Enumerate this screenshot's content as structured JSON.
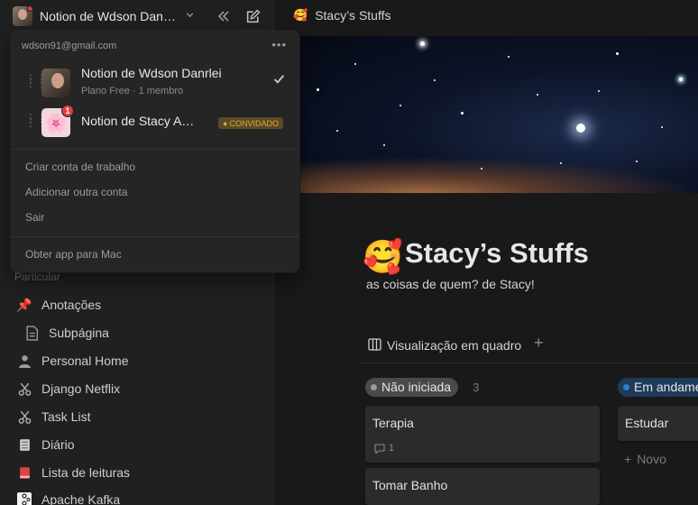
{
  "sidebar": {
    "workspace_name": "Notion de Wdson Dan…",
    "section_label": "Particular",
    "items": [
      {
        "label": "Anotações",
        "icon": "pushpin-icon"
      },
      {
        "label": "Subpágina",
        "icon": "page-icon"
      },
      {
        "label": "Personal Home",
        "icon": "person-icon"
      },
      {
        "label": "Django Netflix",
        "icon": "scissors-icon"
      },
      {
        "label": "Task List",
        "icon": "scissors-icon"
      },
      {
        "label": "Diário",
        "icon": "calendar-icon"
      },
      {
        "label": "Lista de leituras",
        "icon": "book-icon"
      },
      {
        "label": "Apache Kafka",
        "icon": "kafka-logo-icon"
      }
    ]
  },
  "dropdown": {
    "email": "wdson91@gmail.com",
    "accounts": [
      {
        "title": "Notion de Wdson Danrlei",
        "subtitle": "Plano Free · 1 membro",
        "selected": true
      },
      {
        "title": "Notion de Stacy A…",
        "badge": "1",
        "guest_label": "CONVIDADO"
      }
    ],
    "links": [
      "Criar conta de trabalho",
      "Adicionar outra conta",
      "Sair"
    ],
    "footer_link": "Obter app para Mac"
  },
  "topbar": {
    "emoji": "🥰",
    "title": "Stacy’s Stuffs"
  },
  "page": {
    "emoji": "🥰",
    "title": "Stacy’s Stuffs",
    "description": "as coisas de quem? de Stacy!",
    "view_tab": "Visualização em quadro"
  },
  "board": {
    "columns": [
      {
        "label": "Não iniciada",
        "count": "3",
        "color": "#9b9b9b",
        "pill_bg": "#4a4a4a",
        "cards": [
          {
            "title": "Terapia",
            "comments": "1"
          },
          {
            "title": "Tomar Banho"
          }
        ]
      },
      {
        "label": "Em andamento",
        "color": "#2e7fd0",
        "pill_bg": "#1f3a5a",
        "cards": [
          {
            "title": "Estudar"
          }
        ],
        "new_label": "Novo"
      }
    ]
  },
  "colors": {
    "background": "#191919",
    "sidebar": "#202020",
    "accent_blue": "#2e7fd0",
    "notification_red": "#e03e3e"
  }
}
